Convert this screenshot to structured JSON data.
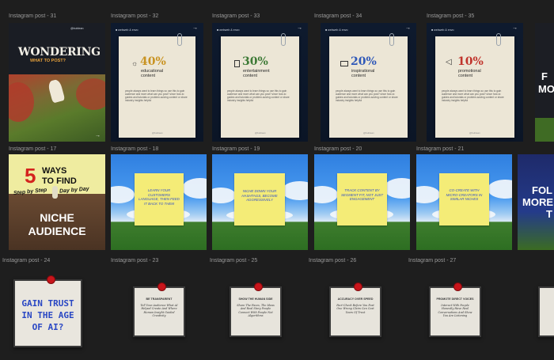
{
  "labels": {
    "p31": "Instagram post - 31",
    "p32": "Instagram post - 32",
    "p33": "Instagram post - 33",
    "p34": "Instagram post - 34",
    "p35": "Instagram post - 35",
    "p17": "Instagram post - 17",
    "p18": "Instagram post - 18",
    "p19": "Instagram post - 19",
    "p20": "Instagram post - 20",
    "p21": "Instagram post - 21",
    "p24": "Instagram post - 24",
    "p23": "Instagram post - 23",
    "p25": "Instagram post - 25",
    "p26": "Instagram post - 26",
    "p27": "Instagram post - 27"
  },
  "post31": {
    "title": "WONDERING",
    "subtitle": "WHAT TO POST?",
    "handle": "@bublean"
  },
  "content_tag": "■ webweb & envo",
  "post32": {
    "percent": "40%",
    "sub1": "educational",
    "sub2": "content",
    "color": "#c99322"
  },
  "post33": {
    "percent": "30%",
    "sub1": "entertainment",
    "sub2": "content",
    "color": "#3d7a36"
  },
  "post34": {
    "percent": "20%",
    "sub1": "inspirational",
    "sub2": "content",
    "color": "#2f58b8"
  },
  "post35": {
    "percent": "10%",
    "sub1": "promotional",
    "sub2": "content",
    "color": "#c0342c"
  },
  "body_text": "people always want to learn things so use this to gain audience and more what can you post? since how-to guides and tutorials or problem-solving content or share industry insights helpful",
  "handle": "@bublean",
  "post17": {
    "big": "5",
    "ways": "WAYS",
    "tofind": "TO FIND",
    "step": "Step by Step",
    "day": "Day by Day",
    "niche": "NICHE",
    "audience": "AUDIENCE"
  },
  "post18": {
    "note": "LEARN YOUR CUSTOMERS LANGUAGE, THEN FEED IT BACK TO THEM"
  },
  "post19": {
    "note": "NICHE DOWN YOUR HASHTAGS, BECOME AGGRESSIVELY"
  },
  "post20": {
    "note": "TRACK CONTENT BY SEGMENT FIT, NOT JUST ENGAGEMENT"
  },
  "post21": {
    "note": "CO-CREATE WITH MICRO-CREATORS IN SIMILAR NICHES"
  },
  "edge_fol": {
    "l1": "FOL",
    "l2": "MORE",
    "l3": "T"
  },
  "edge_f": {
    "l1": "F",
    "l2": "MO"
  },
  "post24": {
    "line1": "GAIN TRUST",
    "line2": "IN THE AGE",
    "line3": "OF AI?"
  },
  "post23": {
    "head": "BE TRANSPARENT",
    "body": "Tell Your Audience What AI Helped Create And Where Human Insight Guided Creativity"
  },
  "post25": {
    "head": "SHOW THE HUMAN SIDE",
    "body": "Share The Faces, The Ideas And Real Story People Connect With People Not Algorithms"
  },
  "post26": {
    "head": "ACCURACY OVER SPEED",
    "body": "Fact-Check Before You Post One Wrong Claim Can Cost Years Of Trust"
  },
  "post27": {
    "head": "PROMOTE DIRECT VOICES",
    "body": "Interact With People Honestly Have Real Conversations And Show You Are Listening"
  }
}
